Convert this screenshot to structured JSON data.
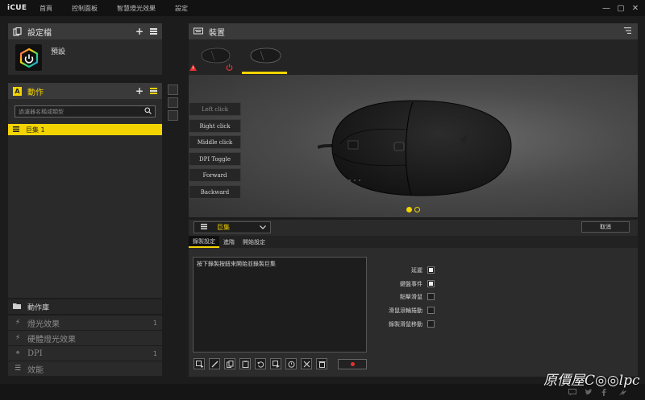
{
  "app": {
    "logo": "iCUE"
  },
  "topnav": [
    "首頁",
    "控制面板",
    "智慧燈光效果",
    "設定"
  ],
  "window_controls": {
    "minimize": "—",
    "maximize": "▢",
    "close": "✕"
  },
  "profiles": {
    "title": "設定檔",
    "plus": "+",
    "items": [
      {
        "name": "預設"
      }
    ]
  },
  "actions": {
    "title": "動作",
    "title_badge": "A",
    "plus": "+",
    "search_placeholder": "過濾器名稱或類型",
    "items": [
      {
        "label": "巨集 1",
        "selected": true
      }
    ]
  },
  "library": {
    "title": "動作庫",
    "items": [
      {
        "label": "燈光效果",
        "count": "1",
        "icon": "lightning-icon",
        "glyph": "⚡"
      },
      {
        "label": "硬體燈光效果",
        "count": "",
        "icon": "lightning-icon",
        "glyph": "⚡"
      },
      {
        "label": "DPI",
        "count": "1",
        "icon": "pointer-icon",
        "glyph": "⌖"
      },
      {
        "label": "效能",
        "count": "",
        "icon": "performance-icon",
        "glyph": "☰"
      }
    ]
  },
  "devices": {
    "title": "裝置",
    "tabs": [
      {
        "active": false
      },
      {
        "active": true
      }
    ]
  },
  "mouse_buttons": [
    {
      "label": "Left click",
      "dim": true
    },
    {
      "label": "Right click",
      "dim": false
    },
    {
      "label": "Middle click",
      "dim": false
    },
    {
      "label": "DPI Toggle",
      "dim": false
    },
    {
      "label": "Forward",
      "dim": false
    },
    {
      "label": "Backward",
      "dim": false
    }
  ],
  "pager": {
    "pages": 2,
    "current": 1
  },
  "editor": {
    "selected_action": "巨集",
    "cancel_label": "取消",
    "tabs": [
      {
        "label": "錄製設定",
        "active": true
      },
      {
        "label": "進階",
        "active": false
      },
      {
        "label": "開始設定",
        "active": false
      }
    ],
    "record_hint": "按下錄製按鈕來開始並錄製巨集",
    "options": [
      {
        "label": "延遲",
        "checked": true
      },
      {
        "label": "鍵盤事件",
        "checked": true
      },
      {
        "label": "點擊滑鼠",
        "checked": false
      },
      {
        "label": "滑鼠滾輪捲動",
        "checked": false
      },
      {
        "label": "錄製滑鼠移動",
        "checked": false
      }
    ]
  },
  "watermark": "原價屋C◎◎lpc",
  "colors": {
    "accent": "#f4d400",
    "warning": "#e53232"
  }
}
